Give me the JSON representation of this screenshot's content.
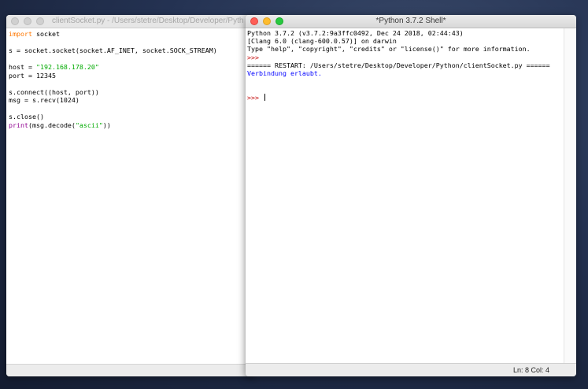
{
  "editor": {
    "title": "clientSocket.py - /Users/stetre/Desktop/Developer/Pyth",
    "lines": [
      {
        "parts": [
          {
            "t": "import",
            "c": "kw"
          },
          {
            "t": " socket",
            "c": ""
          }
        ]
      },
      {
        "parts": []
      },
      {
        "parts": [
          {
            "t": "s = socket.socket(socket.AF_INET, socket.SOCK_STREAM)",
            "c": ""
          }
        ]
      },
      {
        "parts": []
      },
      {
        "parts": [
          {
            "t": "host = ",
            "c": ""
          },
          {
            "t": "\"192.168.178.20\"",
            "c": "str"
          }
        ]
      },
      {
        "parts": [
          {
            "t": "port = 12345",
            "c": ""
          }
        ]
      },
      {
        "parts": []
      },
      {
        "parts": [
          {
            "t": "s.connect((host, port))",
            "c": ""
          }
        ]
      },
      {
        "parts": [
          {
            "t": "msg = s.recv(1024)",
            "c": ""
          }
        ]
      },
      {
        "parts": []
      },
      {
        "parts": [
          {
            "t": "s.close()",
            "c": ""
          }
        ]
      },
      {
        "parts": [
          {
            "t": "print",
            "c": "bi"
          },
          {
            "t": "(msg.decode(",
            "c": ""
          },
          {
            "t": "\"ascii\"",
            "c": "str"
          },
          {
            "t": "))",
            "c": ""
          }
        ]
      }
    ]
  },
  "shell": {
    "title": "*Python 3.7.2 Shell*",
    "lines": [
      {
        "text": "Python 3.7.2 (v3.7.2:9a3ffc0492, Dec 24 2018, 02:44:43)",
        "c": ""
      },
      {
        "text": "[Clang 6.0 (clang-600.0.57)] on darwin",
        "c": ""
      },
      {
        "text": "Type \"help\", \"copyright\", \"credits\" or \"license()\" for more information.",
        "c": ""
      },
      {
        "text": ">>>",
        "c": "prompt"
      },
      {
        "text": "====== RESTART: /Users/stetre/Desktop/Developer/Python/clientSocket.py ======",
        "c": "restart"
      },
      {
        "text": "Verbindung erlaubt.",
        "c": "stdout"
      },
      {
        "text": "",
        "c": ""
      },
      {
        "text": "",
        "c": ""
      },
      {
        "text": ">>> ",
        "c": "prompt",
        "cursor": true
      }
    ],
    "status": {
      "ln": "Ln: 8",
      "col": "Col: 4"
    }
  },
  "colors": {
    "keyword": "#ff7700",
    "string": "#00aa00",
    "builtin": "#900090",
    "prompt": "#c00000",
    "stdout": "#0000ff"
  }
}
